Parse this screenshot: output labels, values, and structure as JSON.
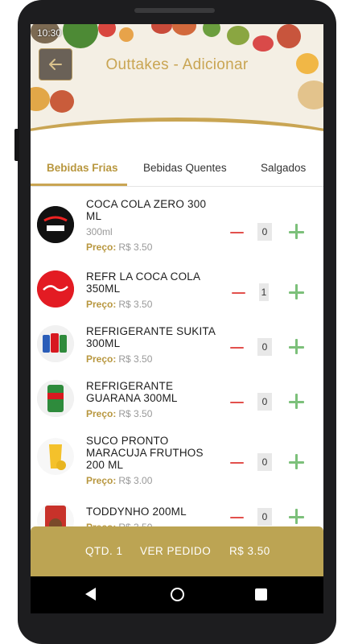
{
  "status_time": "10:30",
  "header": {
    "title": "Outtakes - Adicionar"
  },
  "tabs": [
    {
      "label": "Bebidas Frias",
      "active": true
    },
    {
      "label": "Bebidas Quentes",
      "active": false
    },
    {
      "label": "Salgados",
      "active": false
    }
  ],
  "price_label": "Preço:",
  "items": [
    {
      "name": "COCA COLA ZERO 300 ML",
      "subtitle": "300ml",
      "price": "R$ 3.50",
      "qty": "0",
      "image": "coca-cola-zero-logo"
    },
    {
      "name": "REFR LA COCA COLA 350ML",
      "subtitle": "",
      "price": "R$ 3.50",
      "qty": "1",
      "image": "coca-cola-logo"
    },
    {
      "name": "REFRIGERANTE SUKITA 300ML",
      "subtitle": "",
      "price": "R$ 3.50",
      "qty": "0",
      "image": "soda-cans"
    },
    {
      "name": "REFRIGERANTE GUARANA 300ML",
      "subtitle": "",
      "price": "R$ 3.50",
      "qty": "0",
      "image": "guarana-can"
    },
    {
      "name": "SUCO PRONTO MARACUJA FRUTHOS 200 ML",
      "subtitle": "",
      "price": "R$ 3.00",
      "qty": "0",
      "image": "juice-glass"
    },
    {
      "name": "TODDYNHO 200ML",
      "subtitle": "",
      "price": "R$ 3.50",
      "qty": "0",
      "image": "toddynho-box"
    }
  ],
  "bottom_bar": {
    "qty_text": "QTD. 1",
    "order_button": "VER PEDIDO",
    "total": "R$ 3.50"
  },
  "colors": {
    "accent": "#c9a553",
    "minus": "#e2504c",
    "plus": "#7cc07a",
    "bottom_bar": "#bca453"
  },
  "icons": {
    "back": "arrow-left-icon",
    "nav_back": "triangle-back-icon",
    "nav_home": "circle-home-icon",
    "nav_recent": "square-recents-icon"
  }
}
